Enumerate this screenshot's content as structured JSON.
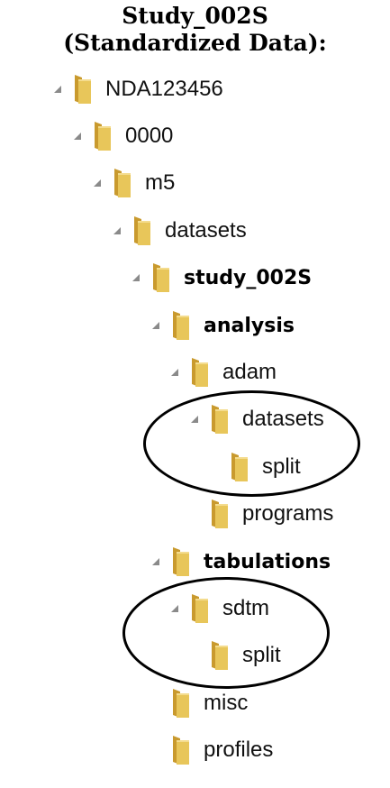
{
  "heading": {
    "line1": "Study_002S",
    "line2": "(Standardized Data):"
  },
  "tree": [
    {
      "label": "NDA123456",
      "bold": false,
      "expanded": true
    },
    {
      "label": "0000",
      "bold": false,
      "expanded": true
    },
    {
      "label": "m5",
      "bold": false,
      "expanded": true
    },
    {
      "label": "datasets",
      "bold": false,
      "expanded": true
    },
    {
      "label": "study_002S",
      "bold": true,
      "expanded": true
    },
    {
      "label": "analysis",
      "bold": true,
      "expanded": true
    },
    {
      "label": "adam",
      "bold": false,
      "expanded": true
    },
    {
      "label": "datasets",
      "bold": false,
      "expanded": true
    },
    {
      "label": "split",
      "bold": false,
      "expanded": false
    },
    {
      "label": "programs",
      "bold": false,
      "expanded": false
    },
    {
      "label": "tabulations",
      "bold": true,
      "expanded": true
    },
    {
      "label": "sdtm",
      "bold": false,
      "expanded": true
    },
    {
      "label": "split",
      "bold": false,
      "expanded": false
    },
    {
      "label": "misc",
      "bold": false,
      "expanded": false
    },
    {
      "label": "profiles",
      "bold": false,
      "expanded": false
    }
  ],
  "colors": {
    "folder_body": "#E8C65A",
    "folder_back": "#C99A2E",
    "expander": "#8A8A8A",
    "highlight_circle": "#000000"
  },
  "icons": {
    "folder": "folder-icon",
    "expander": "expanded-triangle-icon"
  }
}
